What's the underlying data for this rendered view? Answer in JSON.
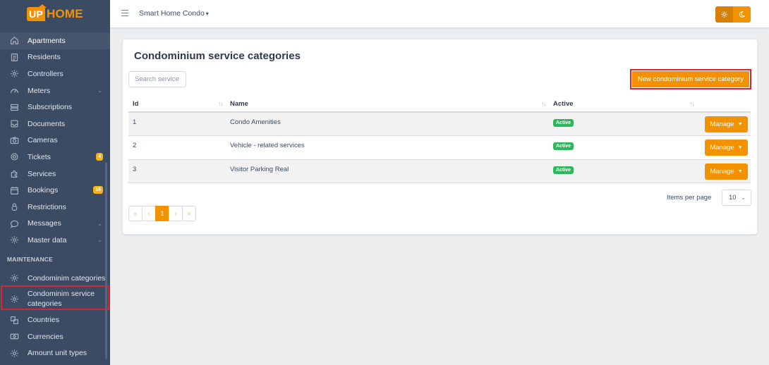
{
  "brand": {
    "up": "UP",
    "home": "HOME"
  },
  "sidebar": {
    "items": [
      {
        "label": "Apartments",
        "icon": "home-icon"
      },
      {
        "label": "Residents",
        "icon": "id-card-icon"
      },
      {
        "label": "Controllers",
        "icon": "gear-icon"
      },
      {
        "label": "Meters",
        "icon": "speedometer-icon"
      },
      {
        "label": "Subscriptions",
        "icon": "server-icon"
      },
      {
        "label": "Documents",
        "icon": "inbox-icon"
      },
      {
        "label": "Cameras",
        "icon": "camera-icon"
      },
      {
        "label": "Tickets",
        "icon": "gear-icon",
        "badge": "4"
      },
      {
        "label": "Services",
        "icon": "puzzle-icon"
      },
      {
        "label": "Bookings",
        "icon": "calendar-icon",
        "badge": "16"
      },
      {
        "label": "Restrictions",
        "icon": "lock-icon"
      },
      {
        "label": "Messages",
        "icon": "chat-icon"
      },
      {
        "label": "Master data",
        "icon": "gear-icon"
      }
    ],
    "maintenance_title": "MAINTENANCE",
    "maintenance_items": [
      {
        "label": "Condominim categories",
        "icon": "gear-icon"
      },
      {
        "label": "Condominim service categories",
        "icon": "gear-icon"
      },
      {
        "label": "Countries",
        "icon": "globe-icon"
      },
      {
        "label": "Currencies",
        "icon": "money-icon"
      },
      {
        "label": "Amount unit types",
        "icon": "gear-icon"
      }
    ]
  },
  "header": {
    "condo": "Smart Home Condo"
  },
  "page": {
    "title": "Condominium service categories",
    "search_placeholder": "Search service c",
    "new_button": "New condominium service category",
    "columns": {
      "id": "Id",
      "name": "Name",
      "active": "Active"
    },
    "rows": [
      {
        "id": "1",
        "name": "Condo Amenities",
        "status": "Active",
        "action": "Manage"
      },
      {
        "id": "2",
        "name": "Vehicle - related services",
        "status": "Active",
        "action": "Manage"
      },
      {
        "id": "3",
        "name": "Visitor Parking Real",
        "status": "Active",
        "action": "Manage"
      }
    ],
    "items_per_page_label": "Items per page",
    "items_per_page": "10",
    "pagination": {
      "first": "«",
      "prev": "‹",
      "current": "1",
      "next": "›",
      "last": "»"
    }
  },
  "colors": {
    "accent": "#f39200",
    "sidebar": "#3c4b64",
    "success": "#2eb85c",
    "highlight": "#e52027"
  }
}
